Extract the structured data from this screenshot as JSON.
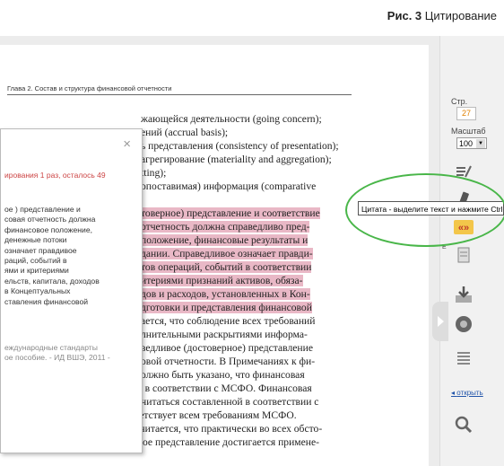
{
  "caption": {
    "prefix": "Рис. 3",
    "title": "Цитирование"
  },
  "document": {
    "chapter_header": "Глава 2. Состав и структура финансовой отчетности",
    "lines": [
      {
        "text": "жающейся деятельности (going concern);",
        "hl": false
      },
      {
        "text": "ений (accrual basis);",
        "hl": false
      },
      {
        "text": "ь представления (consistency of presentation);",
        "hl": false
      },
      {
        "text": "агрегирование (materiality and aggregation);",
        "hl": false
      },
      {
        "text": "tting);",
        "hl": false
      },
      {
        "text": "опоставимая) информация (comparative",
        "hl": false
      },
      {
        "text": "",
        "hl": false
      },
      {
        "text": "товерное) представление и соответствие",
        "hl": true
      },
      {
        "text": "отчетность должна справедливо пред-",
        "hl": true
      },
      {
        "text": "положение, финансовые результаты и",
        "hl": true
      },
      {
        "text": "дании. Справедливое означает правди-",
        "hl": true
      },
      {
        "text": "тов операций, событий в соответствии",
        "hl": true
      },
      {
        "text": "итериями признаний активов, обяза-",
        "hl": true
      },
      {
        "text": "дов и расходов, установленных в Кон-",
        "hl": true
      },
      {
        "text": "дготовки и представления финансовой",
        "hl": true
      },
      {
        "text": "ается, что соблюдение всех требований",
        "hl": false
      },
      {
        "text": "лнительными раскрытиями информа-",
        "hl": false
      },
      {
        "text": "ведливое (достоверное) представление",
        "hl": false
      },
      {
        "text": "овой отчетности. В Примечаниях к фи-",
        "hl": false
      },
      {
        "text": "олжно быть указано, что финансовая",
        "hl": false
      }
    ],
    "full_lines": [
      "отчетность составлена в соответствии с МСФО. Финансовая",
      "отчетность не может считаться составленной в соответствии с",
      "МСФО, если не соответствует всем требованиям МСФО."
    ],
    "last_para": "Таким образом, считается, что практически во всех обсто-",
    "last_line": "ятельствах справедливое представление достигается примене-"
  },
  "popup": {
    "close": "×",
    "limit_text": "ирования 1 раз, осталось 49",
    "quote_lines": [
      "ое ) представление и",
      "совая отчетность должна",
      "финансовое положение,",
      "денежные потоки",
      "означает правдивое",
      "раций, событий в",
      "ями и критериями",
      "ельств, капитала, доходов",
      "в Концептуальных",
      "ставления финансовой"
    ],
    "source_lines": [
      "еждународные стандарты",
      "ое пособие. - ИД ВШЭ, 2011 -"
    ]
  },
  "sidebar": {
    "page_label": "Стр.",
    "page_value": "27",
    "zoom_label": "Масштаб",
    "zoom_value": "100",
    "open_link": "открыть",
    "side_letter": "Е"
  },
  "tooltip": "Цитата - выделите текст и нажмите Ctrl+C",
  "colors": {
    "highlight": "#e9b8c6",
    "accent": "#e08000",
    "oval": "#49b649",
    "link": "#2255aa"
  }
}
